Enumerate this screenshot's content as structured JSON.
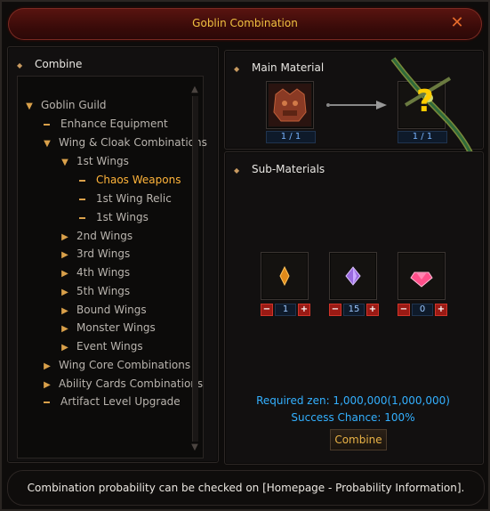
{
  "window": {
    "title": "Goblin Combination",
    "close_symbol": "✕"
  },
  "left": {
    "header": "Combine",
    "tree": [
      {
        "label": "Goblin Guild",
        "marker": "down"
      },
      {
        "label": "Enhance Equipment",
        "marker": "dash"
      },
      {
        "label": "Wing & Cloak Combinations",
        "marker": "down"
      },
      {
        "label": "1st Wings",
        "marker": "down"
      },
      {
        "label": "Chaos Weapons",
        "marker": "dash",
        "active": true
      },
      {
        "label": "1st Wing Relic",
        "marker": "dash"
      },
      {
        "label": "1st Wings",
        "marker": "dash"
      },
      {
        "label": "2nd Wings",
        "marker": "right"
      },
      {
        "label": "3rd Wings",
        "marker": "right"
      },
      {
        "label": "4th Wings",
        "marker": "right"
      },
      {
        "label": "5th Wings",
        "marker": "right"
      },
      {
        "label": "Bound Wings",
        "marker": "right"
      },
      {
        "label": "Monster Wings",
        "marker": "right"
      },
      {
        "label": "Event Wings",
        "marker": "right"
      },
      {
        "label": "Wing Core Combinations",
        "marker": "right"
      },
      {
        "label": "Ability Cards Combinations",
        "marker": "right"
      },
      {
        "label": "Artifact Level Upgrade",
        "marker": "dash"
      }
    ]
  },
  "main_material": {
    "header": "Main Material",
    "input_count": "1 / 1",
    "result_count": "1 / 1",
    "result_unknown": "?"
  },
  "sub_materials": {
    "header": "Sub-Materials",
    "items": [
      {
        "icon": "orange-gem-icon",
        "count": "1"
      },
      {
        "icon": "purple-gem-icon",
        "count": "15"
      },
      {
        "icon": "pink-gem-icon",
        "count": "0"
      }
    ]
  },
  "info": {
    "required_zen": "Required zen: 1,000,000(1,000,000)",
    "success_chance": "Success Chance: 100%"
  },
  "buttons": {
    "combine": "Combine",
    "minus": "−",
    "plus": "+"
  },
  "footer": {
    "text": "Combination probability can be checked on [Homepage - Probability Information]."
  },
  "colors": {
    "accent": "#ffb43a",
    "title": "#f0c040",
    "info": "#33b0ff"
  }
}
